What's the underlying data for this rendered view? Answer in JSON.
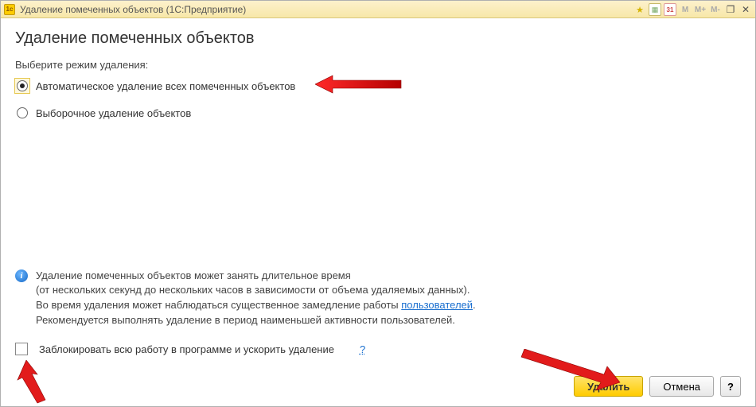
{
  "window": {
    "title": "Удаление помеченных объектов  (1С:Предприятие)",
    "calendar_day": "31",
    "m1": "M",
    "m2": "M+",
    "m3": "M-"
  },
  "page": {
    "heading": "Удаление помеченных объектов",
    "mode_prompt": "Выберите режим удаления:"
  },
  "modes": {
    "auto": "Автоматическое удаление всех помеченных объектов",
    "selective": "Выборочное удаление объектов"
  },
  "info": {
    "line1": "Удаление помеченных объектов может занять длительное время",
    "line2a": "(от нескольких секунд до нескольких часов в зависимости от объема удаляемых данных).",
    "line2b_prefix": "Во время удаления может наблюдаться существенное замедление работы ",
    "users_link": "пользователей",
    "line2b_suffix": ".",
    "line3": "Рекомендуется выполнять удаление в период наименьшей активности пользователей."
  },
  "block_check": {
    "label": "Заблокировать всю работу в программе и ускорить удаление",
    "help": "?"
  },
  "buttons": {
    "delete": "Удалить",
    "cancel": "Отмена",
    "help": "?"
  }
}
